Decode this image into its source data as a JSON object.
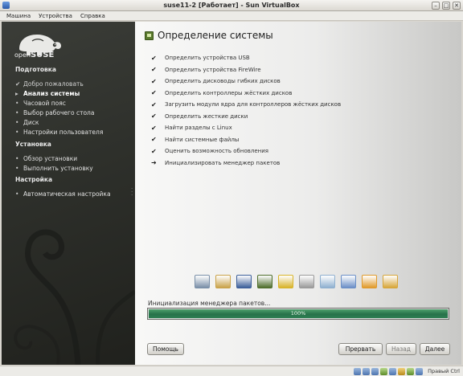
{
  "window": {
    "title": "suse11-2 [Работает] - Sun VirtualBox",
    "controls": [
      "minimize",
      "maximize",
      "close"
    ]
  },
  "menubar": {
    "items": [
      "Машина",
      "Устройства",
      "Справка"
    ]
  },
  "sidebar": {
    "logo": {
      "prefix": "open",
      "name": "SUSE"
    },
    "sections": [
      {
        "title": "Подготовка",
        "items": [
          {
            "label": "Добро пожаловать",
            "state": "done"
          },
          {
            "label": "Анализ системы",
            "state": "current"
          },
          {
            "label": "Часовой пояс",
            "state": "pending"
          },
          {
            "label": "Выбор рабочего стола",
            "state": "pending"
          },
          {
            "label": "Диск",
            "state": "pending"
          },
          {
            "label": "Настройки пользователя",
            "state": "pending"
          }
        ]
      },
      {
        "title": "Установка",
        "items": [
          {
            "label": "Обзор установки",
            "state": "pending"
          },
          {
            "label": "Выполнить установку",
            "state": "pending"
          }
        ]
      },
      {
        "title": "Настройка",
        "items": [
          {
            "label": "Автоматическая настройка",
            "state": "pending"
          }
        ]
      }
    ],
    "markers": {
      "done": "✔",
      "current": "▸",
      "pending": "•"
    }
  },
  "main": {
    "heading": "Определение системы",
    "steps": [
      {
        "label": "Определить устройства USB",
        "state": "done"
      },
      {
        "label": "Определить устройства FireWire",
        "state": "done"
      },
      {
        "label": "Определить дисководы гибких дисков",
        "state": "done"
      },
      {
        "label": "Определить контроллеры жёстких дисков",
        "state": "done"
      },
      {
        "label": "Загрузить модули ядра для контроллеров жёстких дисков",
        "state": "done"
      },
      {
        "label": "Определить жесткие диски",
        "state": "done"
      },
      {
        "label": "Найти разделы с Linux",
        "state": "done"
      },
      {
        "label": "Найти системные файлы",
        "state": "done"
      },
      {
        "label": "Оценить возможность обновления",
        "state": "done"
      },
      {
        "label": "Инициализировать менеджер пакетов",
        "state": "current"
      }
    ],
    "step_markers": {
      "done": "✔",
      "current": "➜"
    },
    "device_icons": [
      {
        "name": "usb-icon",
        "color": "#7a8fa8"
      },
      {
        "name": "firewire-icon",
        "color": "#c9a24a"
      },
      {
        "name": "floppy-icon",
        "color": "#3d5f9a"
      },
      {
        "name": "hdd-controller-icon",
        "color": "#4f6e2c"
      },
      {
        "name": "kernel-module-warning-icon",
        "color": "#d8b42a"
      },
      {
        "name": "hard-disk-icon",
        "color": "#9a9a9a"
      },
      {
        "name": "search-partitions-icon",
        "color": "#8fb0cf"
      },
      {
        "name": "system-files-icon",
        "color": "#6b8fc7"
      },
      {
        "name": "update-check-icon",
        "color": "#e09a2b"
      },
      {
        "name": "package-manager-icon",
        "color": "#d7a63a"
      }
    ],
    "progress": {
      "label": "Инициализация менеджера пакетов...",
      "percent_text": "100%",
      "value": 1.0
    },
    "buttons": {
      "help": "Помощь",
      "abort": "Прервать",
      "back": "Назад",
      "next": "Далее"
    }
  },
  "statusbar": {
    "hostkey": "Правый Ctrl"
  },
  "colors": {
    "sidebar_bg": "#2f312c",
    "accent_green": "#2f7f52",
    "logo_green": "#6fa13b"
  }
}
